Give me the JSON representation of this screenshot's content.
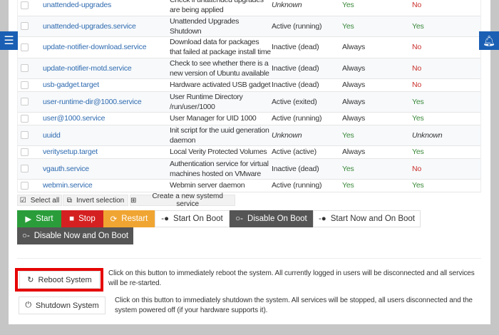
{
  "rows": [
    {
      "name": "unattended-upgrades",
      "desc": "Check if unattended upgrades are being applied",
      "status": "Unknown",
      "boot": "Yes",
      "running": "No"
    },
    {
      "name": "unattended-upgrades.service",
      "desc": "Unattended Upgrades Shutdown",
      "status": "Active (running)",
      "boot": "Yes",
      "running": "Yes"
    },
    {
      "name": "update-notifier-download.service",
      "desc": "Download data for packages that failed at package install time",
      "status": "Inactive (dead)",
      "boot": "Always",
      "running": "No"
    },
    {
      "name": "update-notifier-motd.service",
      "desc": "Check to see whether there is a new version of Ubuntu available",
      "status": "Inactive (dead)",
      "boot": "Always",
      "running": "No"
    },
    {
      "name": "usb-gadget.target",
      "desc": "Hardware activated USB gadget",
      "status": "Inactive (dead)",
      "boot": "Always",
      "running": "No"
    },
    {
      "name": "user-runtime-dir@1000.service",
      "desc": "User Runtime Directory /run/user/1000",
      "status": "Active (exited)",
      "boot": "Always",
      "running": "Yes"
    },
    {
      "name": "user@1000.service",
      "desc": "User Manager for UID 1000",
      "status": "Active (running)",
      "boot": "Always",
      "running": "Yes"
    },
    {
      "name": "uuidd",
      "desc": "Init script for the uuid generation daemon",
      "status": "Unknown",
      "boot": "Yes",
      "running": "Unknown"
    },
    {
      "name": "veritysetup.target",
      "desc": "Local Verity Protected Volumes",
      "status": "Active (active)",
      "boot": "Always",
      "running": "Yes"
    },
    {
      "name": "vgauth.service",
      "desc": "Authentication service for virtual machines hosted on VMware",
      "status": "Inactive (dead)",
      "boot": "Yes",
      "running": "No"
    },
    {
      "name": "webmin.service",
      "desc": "Webmin server daemon",
      "status": "Active (running)",
      "boot": "Yes",
      "running": "Yes"
    }
  ],
  "selection": {
    "select_all": "Select all",
    "invert": "Invert selection",
    "create": "Create a new systemd service"
  },
  "actions": {
    "start": "Start",
    "stop": "Stop",
    "restart": "Restart",
    "start_on_boot": "Start On Boot",
    "disable_on_boot": "Disable On Boot",
    "start_now_boot": "Start Now and On Boot",
    "disable_now_boot": "Disable Now and On Boot"
  },
  "system": {
    "reboot_label": "Reboot System",
    "reboot_desc": "Click on this button to immediately reboot the system. All currently logged in users will be disconnected and all services will be re-started.",
    "shutdown_label": "Shutdown System",
    "shutdown_desc": "Click on this button to immediately shutdown the system. All services will be stopped, all users disconnected and the system powered off (if your hardware supports it)."
  },
  "colors": {
    "accent": "#1a5fb4",
    "highlight": "#e60000"
  }
}
